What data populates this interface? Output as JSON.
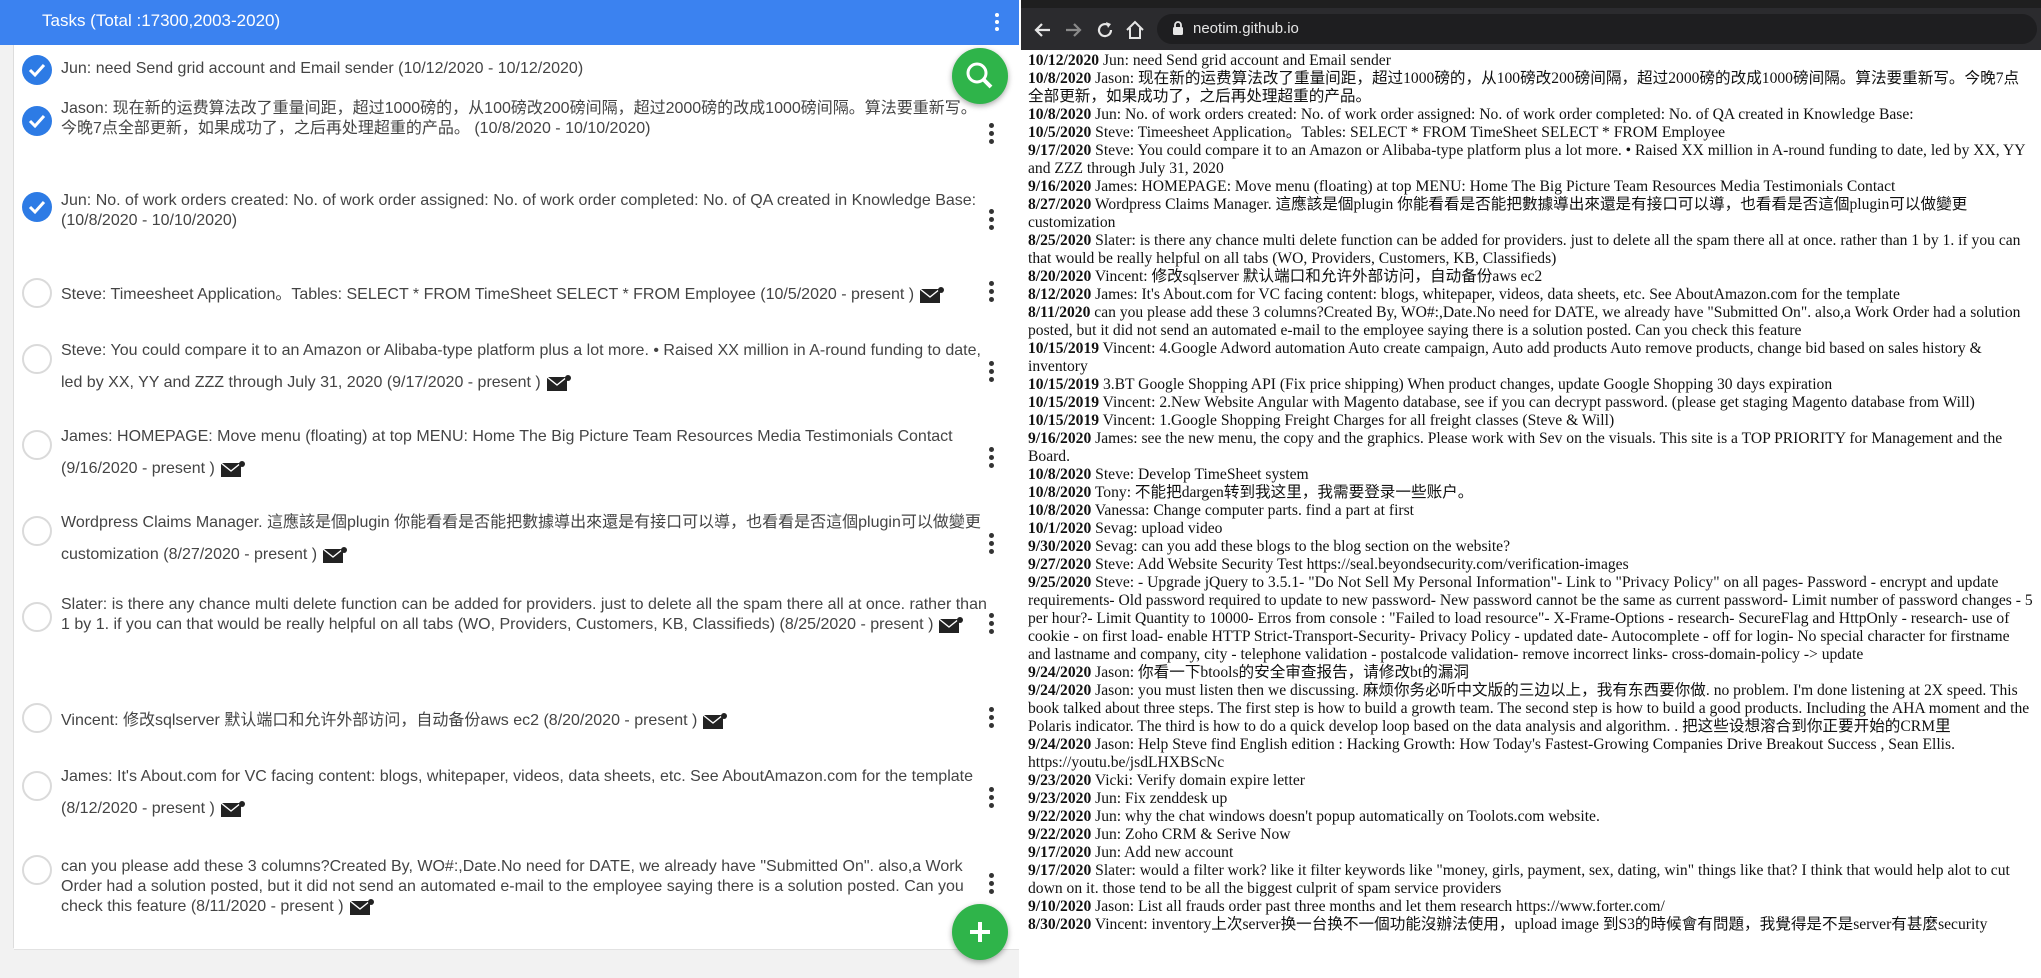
{
  "app": {
    "title": "Tasks (Total :17300,2003-2020)"
  },
  "tasks": [
    {
      "text": "Jun: need Send grid account and Email sender (10/12/2020 - 10/12/2020)",
      "done": true
    },
    {
      "text": "Jason: 现在新的运费算法改了重量间距，超过1000磅的，从100磅改200磅间隔，超过2000磅的改成1000磅间隔。算法要重新写。今晚7点全部更新，如果成功了，之后再处理超重的产品。 (10/8/2020 - 10/10/2020)",
      "done": true
    },
    {
      "text": "Jun: No. of work orders created: No. of work order assigned: No. of work order completed: No. of QA created in Knowledge Base: (10/8/2020 - 10/10/2020)",
      "done": true
    },
    {
      "text": "Steve: Timeesheet Application。Tables: SELECT * FROM TimeSheet SELECT * FROM Employee (10/5/2020 - present )",
      "done": false
    },
    {
      "text": "Steve: You could compare it to an Amazon or Alibaba-type platform plus a lot more. • Raised XX million in A-round funding to date, led by XX, YY and ZZZ through July 31, 2020 (9/17/2020 - present )",
      "done": false
    },
    {
      "text": "James: HOMEPAGE: Move menu (floating) at top MENU: Home The Big Picture Team Resources Media Testimonials Contact (9/16/2020 - present )",
      "done": false
    },
    {
      "text": "Wordpress Claims Manager. 這應該是個plugin 你能看看是否能把數據導出來還是有接口可以導，也看看是否這個plugin可以做變更 customization (8/27/2020 - present )",
      "done": false
    },
    {
      "text": "Slater: is there any chance multi delete function can be added for providers. just to delete all the spam there all at once. rather than 1 by 1. if you can that would be really helpful on all tabs (WO, Providers, Customers, KB, Classifieds) (8/25/2020 - present )",
      "done": false
    },
    {
      "text": "Vincent: 修改sqlserver 默认端口和允许外部访问，自动备份aws ec2 (8/20/2020 - present )",
      "done": false
    },
    {
      "text": "James: It's About.com for VC facing content: blogs, whitepaper, videos, data sheets, etc. See AboutAmazon.com for the template (8/12/2020 - present )",
      "done": false
    },
    {
      "text": "can you please add these 3 columns?Created By, WO#:,Date.No need for DATE, we already have \"Submitted On\". also,a Work Order had a solution posted, but it did not send an automated e-mail to the employee saying there is a solution posted. Can you check this feature (8/11/2020 - present )",
      "done": false
    }
  ],
  "browser": {
    "url": "neotim.github.io"
  },
  "log": [
    {
      "date": "10/12/2020",
      "text": "Jun: need Send grid account and Email sender"
    },
    {
      "date": "10/8/2020",
      "text": "Jason: 现在新的运费算法改了重量间距，超过1000磅的，从100磅改200磅间隔，超过2000磅的改成1000磅间隔。算法要重新写。今晚7点全部更新，如果成功了，之后再处理超重的产品。"
    },
    {
      "date": "10/8/2020",
      "text": "Jun: No. of work orders created: No. of work order assigned: No. of work order completed: No. of QA created in Knowledge Base:"
    },
    {
      "date": "10/5/2020",
      "text": "Steve: Timeesheet Application。Tables: SELECT * FROM TimeSheet SELECT * FROM Employee"
    },
    {
      "date": "9/17/2020",
      "text": "Steve: You could compare it to an Amazon or Alibaba-type platform plus a lot more. • Raised XX million in A-round funding to date, led by XX, YY and ZZZ through July 31, 2020"
    },
    {
      "date": "9/16/2020",
      "text": "James: HOMEPAGE: Move menu (floating) at top MENU: Home The Big Picture Team Resources Media Testimonials Contact"
    },
    {
      "date": "8/27/2020",
      "text": "Wordpress Claims Manager. 這應該是個plugin 你能看看是否能把數據導出來還是有接口可以導，也看看是否這個plugin可以做變更 customization"
    },
    {
      "date": "8/25/2020",
      "text": "Slater: is there any chance multi delete function can be added for providers. just to delete all the spam there all at once. rather than 1 by 1. if you can that would be really helpful on all tabs (WO, Providers, Customers, KB, Classifieds)"
    },
    {
      "date": "8/20/2020",
      "text": "Vincent: 修改sqlserver 默认端口和允许外部访问，自动备份aws ec2"
    },
    {
      "date": "8/12/2020",
      "text": "James: It's About.com for VC facing content: blogs, whitepaper, videos, data sheets, etc. See AboutAmazon.com for the template"
    },
    {
      "date": "8/11/2020",
      "text": "can you please add these 3 columns?Created By, WO#:,Date.No need for DATE, we already have \"Submitted On\". also,a Work Order had a solution posted, but it did not send an automated e-mail to the employee saying there is a solution posted. Can you check this feature"
    },
    {
      "date": "10/15/2019",
      "text": "Vincent: 4.Google Adword automation Auto create campaign, Auto add products Auto remove products, change bid based on sales history & inventory"
    },
    {
      "date": "10/15/2019",
      "text": "3.BT Google Shopping API (Fix price shipping) When product changes, update Google Shopping 30 days expiration"
    },
    {
      "date": "10/15/2019",
      "text": "Vincent: 2.New Website Angular with Magento database, see if you can decrypt password. (please get staging Magento database from Will)"
    },
    {
      "date": "10/15/2019",
      "text": "Vincent: 1.Google Shopping Freight Charges for all freight classes (Steve & Will)"
    },
    {
      "date": "9/16/2020",
      "text": "James: see the new menu, the copy and the graphics. Please work with Sev on the visuals. This site is a TOP PRIORITY for Management and the Board."
    },
    {
      "date": "10/8/2020",
      "text": "Steve: Develop TimeSheet system"
    },
    {
      "date": "10/8/2020",
      "text": "Tony: 不能把dargen转到我这里，我需要登录一些账户。"
    },
    {
      "date": "10/8/2020",
      "text": "Vanessa: Change computer parts. find a part at first"
    },
    {
      "date": "10/1/2020",
      "text": "Sevag: upload video"
    },
    {
      "date": "9/30/2020",
      "text": "Sevag: can you add these blogs to the blog section on the website?"
    },
    {
      "date": "9/27/2020",
      "text": "Steve: Add Website Security Test https://seal.beyondsecurity.com/verification-images"
    },
    {
      "date": "9/25/2020",
      "text": "Steve: - Upgrade jQuery to 3.5.1- \"Do Not Sell My Personal Information\"- Link to \"Privacy Policy\" on all pages- Password - encrypt and update requirements- Old password required to update to new password- New password cannot be the same as current password- Limit number of password changes - 5 per hour?- Limit Quantity to 10000- Erros from console : \"Failed to load resource\"- X-Frame-Options - research- SecureFlag and HttpOnly - research- use of cookie - on first load- enable HTTP Strict-Transport-Security- Privacy Policy - updated date- Autocomplete - off for login- No special character for firstname and lastname and company, city - telephone validation - postalcode validation- remove incorrect links- cross-domain-policy -> update"
    },
    {
      "date": "9/24/2020",
      "text": "Jason: 你看一下btools的安全审查报告，请修改bt的漏洞"
    },
    {
      "date": "9/24/2020",
      "text": "Jason: you must listen then we discussing. 麻烦你务必听中文版的三边以上，我有东西要你做. no problem. I'm done listening at 2X speed. This book talked about three steps. The first step is how to build a growth team. The second step is how to build a good products. Including the AHA moment and the Polaris indicator. The third is how to do a quick develop loop based on the data analysis and algorithm. . 把这些设想溶合到你正要开始的CRM里"
    },
    {
      "date": "9/24/2020",
      "text": "Jason: Help Steve find English edition : Hacking Growth: How Today's Fastest-Growing Companies Drive Breakout Success , Sean Ellis. https://youtu.be/jsdLHXBScNc"
    },
    {
      "date": "9/23/2020",
      "text": "Vicki: Verify domain expire letter"
    },
    {
      "date": "9/23/2020",
      "text": "Jun: Fix zenddesk up"
    },
    {
      "date": "9/22/2020",
      "text": "Jun: why the chat windows doesn't popup automatically on Toolots.com website."
    },
    {
      "date": "9/22/2020",
      "text": "Jun: Zoho CRM & Serive Now"
    },
    {
      "date": "9/17/2020",
      "text": "Jun: Add new account"
    },
    {
      "date": "9/17/2020",
      "text": "Slater: would a filter work? like it filter keywords like \"money, girls, payment, sex, dating, win\" things like that? I think that would help alot to cut down on it. those tend to be all the biggest culprit of spam service providers"
    },
    {
      "date": "9/10/2020",
      "text": "Jason: List all frauds order past three months and let them research https://www.forter.com/"
    },
    {
      "date": "8/30/2020",
      "text": "Vincent: inventory上次server换一台换不一個功能沒辦法使用，upload image 到S3的時候會有問題，我覺得是不是server有甚麼security"
    }
  ]
}
